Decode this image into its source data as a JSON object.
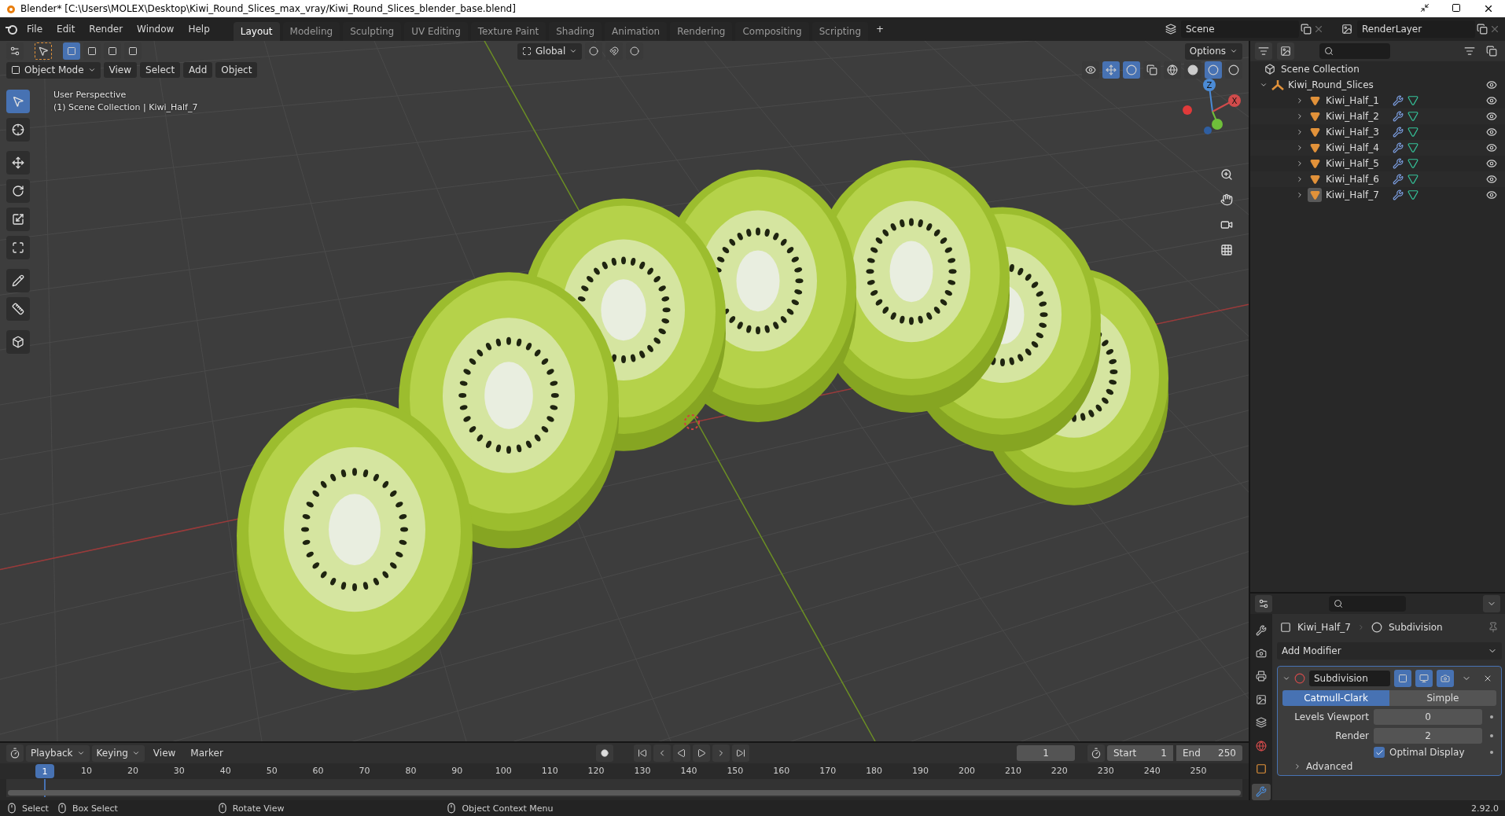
{
  "window": {
    "title": "Blender* [C:\\Users\\MOLEX\\Desktop\\Kiwi_Round_Slices_max_vray/Kiwi_Round_Slices_blender_base.blend]"
  },
  "menu": [
    "File",
    "Edit",
    "Render",
    "Window",
    "Help"
  ],
  "workspaces": [
    {
      "label": "Layout",
      "selected": true
    },
    {
      "label": "Modeling",
      "selected": false
    },
    {
      "label": "Sculpting",
      "selected": false
    },
    {
      "label": "UV Editing",
      "selected": false
    },
    {
      "label": "Texture Paint",
      "selected": false
    },
    {
      "label": "Shading",
      "selected": false
    },
    {
      "label": "Animation",
      "selected": false
    },
    {
      "label": "Rendering",
      "selected": false
    },
    {
      "label": "Compositing",
      "selected": false
    },
    {
      "label": "Scripting",
      "selected": false
    }
  ],
  "add_workspace": "+",
  "scene": {
    "value": "Scene"
  },
  "render_layer": {
    "value": "RenderLayer"
  },
  "viewport_header": {
    "orientation": "Global",
    "options": "Options",
    "mode": "Object Mode",
    "menus": [
      "View",
      "Select",
      "Add",
      "Object"
    ]
  },
  "viewport": {
    "perspective": "User Perspective",
    "context": "(1) Scene Collection | Kiwi_Half_7",
    "gizmo_labels": [
      "Z",
      "X"
    ]
  },
  "outliner": {
    "root": "Scene Collection",
    "children": [
      {
        "label": "Kiwi_Round_Slices",
        "expanded": true,
        "children": [
          {
            "label": "Kiwi_Half_1",
            "selected": false
          },
          {
            "label": "Kiwi_Half_2",
            "selected": false
          },
          {
            "label": "Kiwi_Half_3",
            "selected": false
          },
          {
            "label": "Kiwi_Half_4",
            "selected": false
          },
          {
            "label": "Kiwi_Half_5",
            "selected": false
          },
          {
            "label": "Kiwi_Half_6",
            "selected": false
          },
          {
            "label": "Kiwi_Half_7",
            "selected": true
          }
        ]
      }
    ]
  },
  "properties": {
    "object": "Kiwi_Half_7",
    "modifier_crumb": "Subdivision",
    "add_modifier": "Add Modifier",
    "modifier": {
      "name": "Subdivision",
      "expanded": true,
      "types": [
        {
          "label": "Catmull-Clark",
          "selected": true
        },
        {
          "label": "Simple",
          "selected": false
        }
      ],
      "fields": [
        {
          "label": "Levels Viewport",
          "value": "0"
        },
        {
          "label": "Render",
          "value": "2"
        }
      ],
      "optimal_display": {
        "label": "Optimal Display",
        "checked": true
      },
      "advanced": {
        "label": "Advanced",
        "expanded": false
      }
    }
  },
  "timeline": {
    "menus": [
      "Playback",
      "Keying",
      "View",
      "Marker"
    ],
    "current_frame": "1",
    "start": {
      "label": "Start",
      "value": "1"
    },
    "end": {
      "label": "End",
      "value": "250"
    },
    "playhead": "1",
    "ticks": [
      "10",
      "20",
      "30",
      "40",
      "50",
      "60",
      "70",
      "80",
      "90",
      "100",
      "110",
      "120",
      "130",
      "140",
      "150",
      "160",
      "170",
      "180",
      "190",
      "200",
      "210",
      "220",
      "230",
      "240",
      "250"
    ]
  },
  "status_bar": {
    "hints": [
      "Select",
      "Box Select",
      "Rotate View",
      "Object Context Menu"
    ],
    "version": "2.92.0"
  }
}
